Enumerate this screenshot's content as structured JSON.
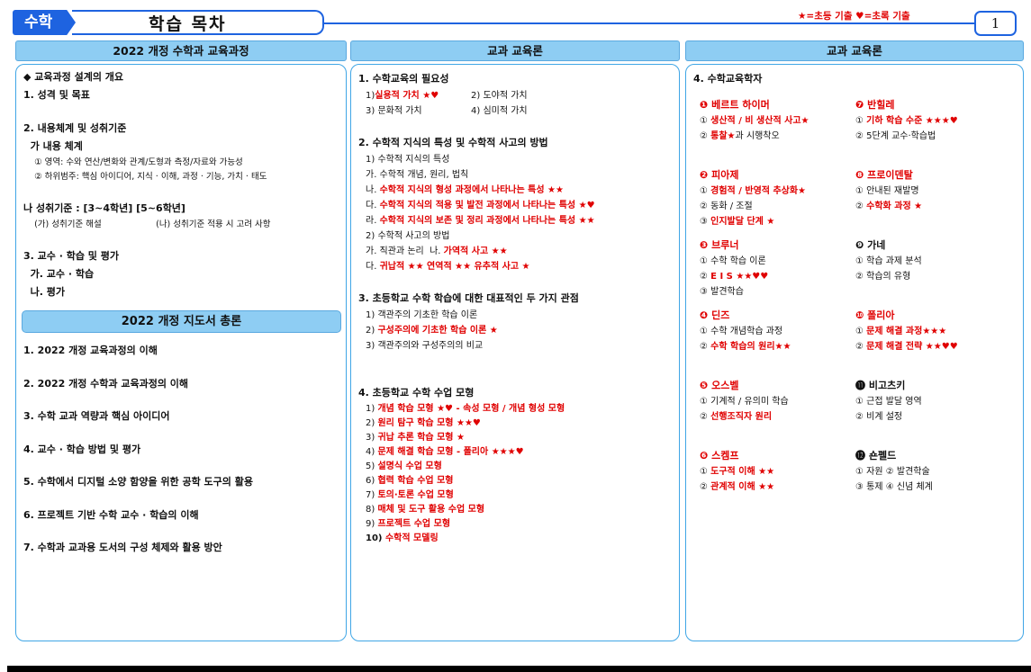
{
  "header": {
    "subject": "수학",
    "title": "학습 목차",
    "legend": "★=초등 기출 ♥=초록 기출",
    "page_number": "1"
  },
  "columns": {
    "col1_title": "2022 개정 수학과 교육과정",
    "col2_title": "교과 교육론",
    "col3_title": "교과 교육론"
  },
  "col1": {
    "curriculum": [
      {
        "text": "◆ 교육과정 설계의 개요",
        "cls": "h"
      },
      {
        "text": "1. 성격 및 목표",
        "cls": "h"
      },
      {
        "text": "",
        "cls": "t"
      },
      {
        "text": "2. 내용체계 및 성취기준",
        "cls": "h"
      },
      {
        "text": "  가 내용 체계",
        "cls": "h"
      },
      {
        "text": "    ① 영역: 수와 연산/변화와 관계/도형과 측정/자료와 가능성",
        "cls": "s"
      },
      {
        "text": "    ② 하위범주: 핵심 아이디어, 지식 · 이해, 과정 · 기능, 가치 · 태도",
        "cls": "s"
      },
      {
        "text": "",
        "cls": "t"
      },
      {
        "text": "나 성취기준 : [3~4학년] [5~6학년]",
        "cls": "h"
      },
      {
        "text": "    (가) 성취기준 해설                    (나) 성취기준 적용 시 고려 사항",
        "cls": "s"
      },
      {
        "text": "",
        "cls": "t"
      },
      {
        "text": "3. 교수 · 학습 및 평가",
        "cls": "h"
      },
      {
        "text": "  가. 교수 · 학습",
        "cls": "h"
      },
      {
        "text": "  나. 평가",
        "cls": "h"
      }
    ],
    "guide_title": "2022 개정 지도서 총론",
    "guide_items": [
      "1. 2022 개정 교육과정의 이해",
      "2. 2022 개정 수학과 교육과정의 이해",
      "3. 수학 교과 역량과 핵심 아이디어",
      "4. 교수 · 학습 방법 및 평가",
      "5. 수학에서 디지털 소양 함양을 위한 공학 도구의 활용",
      "6. 프로젝트 기반 수학 교수 · 학습의 이해",
      "7. 수학과 교과용 도서의 구성 체제와 활용 방안"
    ]
  },
  "col2": {
    "s1_title": "1. 수학교육의 필요성",
    "s1_items": [
      {
        "left": "1) ",
        "left_red": "실용적 가치 ★♥",
        "right": "2) 도야적 가치"
      },
      {
        "left": "3) 문화적 가치",
        "left_red": "",
        "right": "4) 심미적 가치"
      }
    ],
    "s2_title": "2. 수학적 지식의 특성 및 수학적 사고의 방법",
    "s2_items": [
      {
        "a": "1) 수학적 지식의 특성",
        "b": ""
      },
      {
        "a": "가. 수학적 개념, 원리, 법칙",
        "b": ""
      },
      {
        "a": "나. ",
        "b": "수학적 지식의 형성 과정에서 나타나는 특성 ★★"
      },
      {
        "a": "다. ",
        "b": "수학적 지식의 적용 및 발전 과정에서 나타나는 특성 ★♥"
      },
      {
        "a": "라. ",
        "b": "수학적 지식의 보존 및 정리 과정에서 나타나는 특성 ★★"
      },
      {
        "a": "2) 수학적 사고의 방법",
        "b": ""
      },
      {
        "a": "가. 직관과 논리  나. ",
        "b": "가역적 사고 ★★"
      },
      {
        "a": "다. ",
        "b": "귀납적 ★★ 연역적 ★★ 유추적 사고 ★"
      }
    ],
    "s3_title": "3. 초등학교 수학 학습에 대한 대표적인 두 가지 관점",
    "s3_items": [
      {
        "a": "1) 객관주의 기초한 학습 이론",
        "b": ""
      },
      {
        "a": "2) ",
        "b": "구성주의에 기초한 학습 이론 ★"
      },
      {
        "a": "3) 객관주의와 구성주의의 비교",
        "b": ""
      }
    ],
    "s4_title": "4. 초등학교 수학 수업 모형",
    "s4_items": [
      {
        "a": "1) ",
        "b": "개념 학습 모형 ★♥ - 속성 모형 / 개념 형성 모형"
      },
      {
        "a": "2) ",
        "b": "원리 탐구 학습 모형 ★★♥"
      },
      {
        "a": "3) ",
        "b": "귀납 추론 학습 모형 ★"
      },
      {
        "a": "4) ",
        "b": "문제 해결 학습 모형 - 폴리아 ★★★♥"
      },
      {
        "a": "5) ",
        "b": "설명식 수업 모형"
      },
      {
        "a": "6) ",
        "b": "협력 학습 수업 모형"
      },
      {
        "a": "7) ",
        "b": "토의·토론 수업 모형"
      },
      {
        "a": "8) ",
        "b": "매체 및 도구 활용 수업 모형"
      },
      {
        "a": "9) ",
        "b": "프로젝트 수업 모형"
      },
      {
        "a": "10) ",
        "b": "수학적 모델링"
      }
    ]
  },
  "col3": {
    "title": "4. 수학교육학자",
    "left_groups": [
      {
        "head": "❶ 베르트 하이머",
        "red": true,
        "lines": [
          [
            "① ",
            "생산적 / 비 생산적 사고★"
          ],
          [
            "② ",
            "통찰★",
            "과 시행착오"
          ]
        ]
      },
      {
        "head": "❷ 피아제",
        "red": true,
        "lines": [
          [
            "① ",
            "경험적 / 반영적 추상화★"
          ],
          [
            "② 동화 / 조절"
          ],
          [
            "③ ",
            "인지발달 단계 ★"
          ]
        ]
      },
      {
        "head": "❸ 브루너",
        "red": true,
        "lines": [
          [
            "① 수학 학습 이론"
          ],
          [
            "② ",
            "E I S ★★♥♥"
          ],
          [
            "③ 발견학습"
          ]
        ]
      },
      {
        "head": "❹ 딘즈",
        "red": true,
        "lines": [
          [
            "① 수학 개념학습 과정"
          ],
          [
            "② ",
            "수학 학습의 원리★★"
          ]
        ]
      },
      {
        "head": "❺ 오스벨",
        "red": true,
        "lines": [
          [
            "① 기계적 / 유의미 학습"
          ],
          [
            "② ",
            "선행조직자 원리"
          ]
        ]
      },
      {
        "head": "❻ 스켐프",
        "red": true,
        "lines": [
          [
            "① ",
            "도구적 이해 ★★"
          ],
          [
            "② ",
            "관계적 이해 ★★"
          ]
        ]
      }
    ],
    "right_groups": [
      {
        "head": "❼ 반힐레",
        "red": true,
        "lines": [
          [
            "① ",
            "기하 학습 수준 ★★★♥"
          ],
          [
            "② 5단계 교수·학습법"
          ]
        ]
      },
      {
        "head": "❽ 프로이덴탈",
        "red": true,
        "lines": [
          [
            "① 안내된 재발명"
          ],
          [
            "② ",
            "수학화 과정 ★"
          ]
        ]
      },
      {
        "head": "❾ 가네",
        "red": false,
        "lines": [
          [
            "① 학습 과제 분석"
          ],
          [
            "② 학습의 유형"
          ]
        ]
      },
      {
        "head": "❿ 폴리아",
        "red": true,
        "lines": [
          [
            "① ",
            "문제 해결 과정★★★"
          ],
          [
            "② ",
            "문제 해결 전략 ★★♥♥"
          ]
        ]
      },
      {
        "head": "⓫ 비고츠키",
        "red": false,
        "lines": [
          [
            "① 근접 발달 영역"
          ],
          [
            "② 비계 설정"
          ]
        ]
      },
      {
        "head": "⓬ 숀펠드",
        "red": false,
        "lines": [
          [
            "① 자원 ② 발견학술"
          ],
          [
            "③ 통제 ④ 신념 체계"
          ]
        ]
      }
    ]
  }
}
